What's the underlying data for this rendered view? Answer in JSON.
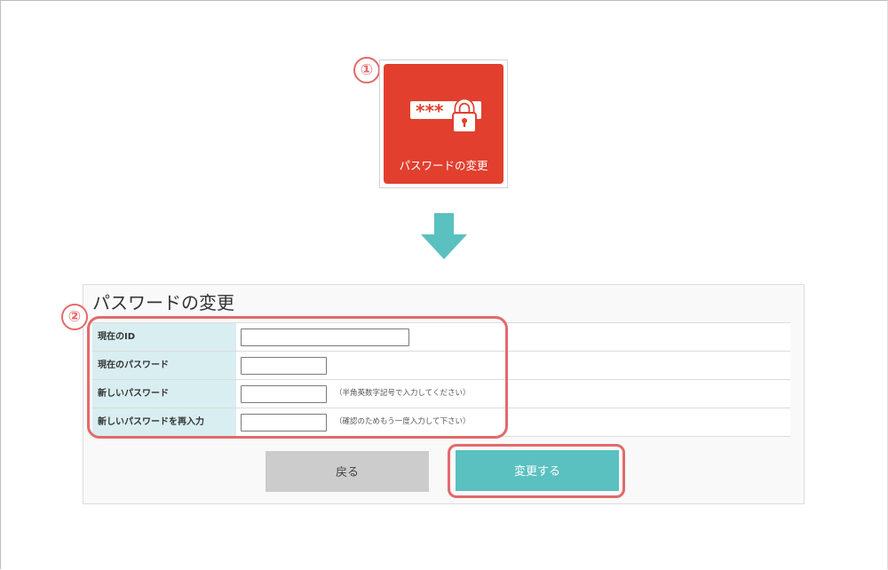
{
  "steps": {
    "one": "①",
    "two": "②"
  },
  "tile": {
    "label": "パスワードの変更",
    "icon": "password-lock-icon",
    "stars": "***",
    "color": "#e23f2e"
  },
  "arrow": {
    "icon": "arrow-down-icon",
    "color": "#5bc0c0"
  },
  "form": {
    "title": "パスワードの変更",
    "rows": [
      {
        "label": "現在のID",
        "value": "",
        "note": ""
      },
      {
        "label": "現在のパスワード",
        "value": "",
        "note": ""
      },
      {
        "label": "新しいパスワード",
        "value": "",
        "note": "（半角英数字記号で入力してください）"
      },
      {
        "label": "新しいパスワードを再入力",
        "value": "",
        "note": "（確認のためもう一度入力して下さい）"
      }
    ]
  },
  "buttons": {
    "back": "戻る",
    "submit": "変更する"
  },
  "colors": {
    "highlight": "#e36a6a",
    "label_bg": "#d9eef0",
    "submit_bg": "#5bc0c0",
    "back_bg": "#cccccc"
  }
}
